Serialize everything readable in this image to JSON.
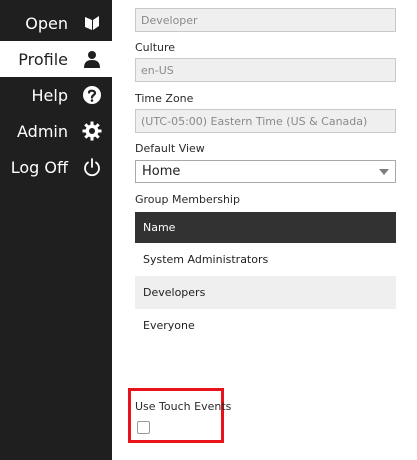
{
  "nav": {
    "items": [
      {
        "label": "Open",
        "icon": "open-book-icon"
      },
      {
        "label": "Profile",
        "icon": "person-icon",
        "active": true
      },
      {
        "label": "Help",
        "icon": "help-icon"
      },
      {
        "label": "Admin",
        "icon": "gear-icon"
      },
      {
        "label": "Log Off",
        "icon": "power-icon"
      }
    ]
  },
  "form": {
    "last_name_value": "Developer",
    "culture_label": "Culture",
    "culture_value": "en-US",
    "timezone_label": "Time Zone",
    "timezone_value": "(UTC-05:00) Eastern Time (US & Canada)",
    "default_view_label": "Default View",
    "default_view_value": "Home",
    "group_label": "Group Membership",
    "group_column": "Name",
    "groups": [
      "System Administrators",
      "Developers",
      "Everyone"
    ],
    "touch_label": "Use Touch Events",
    "touch_checked": false
  },
  "colors": {
    "sidebar": "#1f1f1f",
    "highlight": "#e8121a",
    "grid_header": "#323232"
  }
}
